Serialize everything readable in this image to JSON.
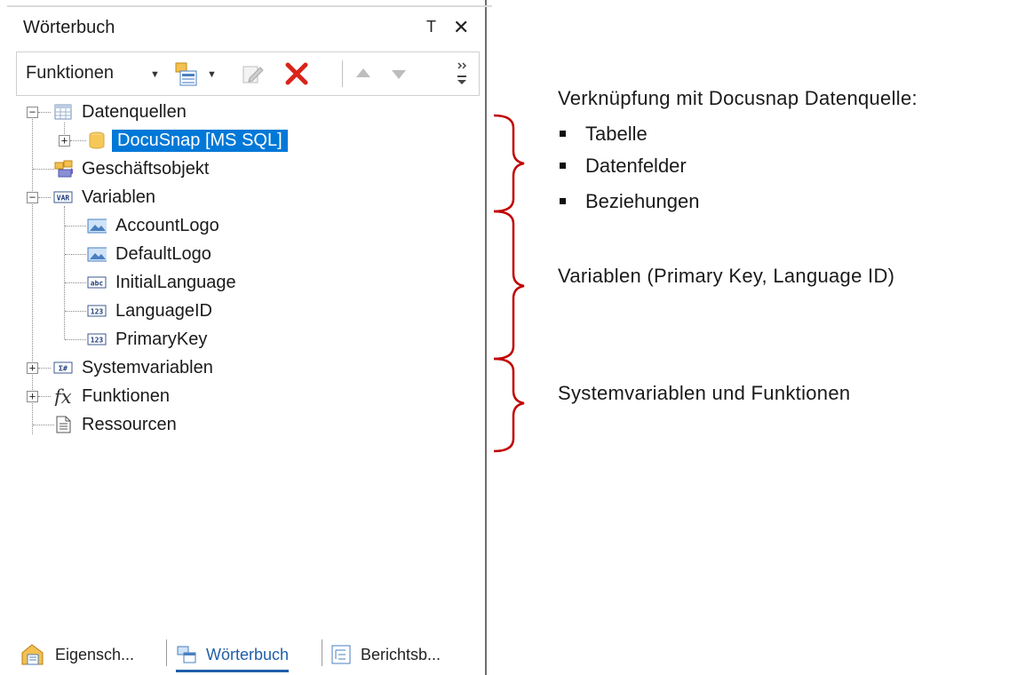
{
  "panel": {
    "title": "Wörterbuch",
    "pin_glyph": "Т",
    "close_glyph": "✕"
  },
  "toolbar": {
    "functions_label": "Funktionen"
  },
  "tree": {
    "datenquellen": "Datenquellen",
    "docusnap": "DocuSnap [MS SQL]",
    "geschaeftsobjekt": "Geschäftsobjekt",
    "variablen": "Variablen",
    "vars": [
      "AccountLogo",
      "DefaultLogo",
      "InitialLanguage",
      "LanguageID",
      "PrimaryKey"
    ],
    "systemvariablen": "Systemvariablen",
    "funktionen": "Funktionen",
    "ressourcen": "Ressourcen"
  },
  "tabs": [
    "Eigensch...",
    "Wörterbuch",
    "Berichtsb..."
  ],
  "annotations": {
    "heading": "Verknüpfung mit Docusnap Datenquelle:",
    "bullets": [
      "Tabelle",
      "Datenfelder",
      "Beziehungen"
    ],
    "variablen_note": "Variablen (Primary Key, Language ID)",
    "system_note": "Systemvariablen und Funktionen"
  },
  "colors": {
    "selection": "#0078d7",
    "bracket": "#c00000",
    "active_tab": "#1f5fa8"
  },
  "icons": {
    "table": "table-icon",
    "database": "database-icon",
    "business_object": "business-object-icon",
    "var": "variable-icon",
    "image": "image-icon",
    "abc": "string-icon",
    "num": "number-icon",
    "sys": "system-variable-icon",
    "fx": "function-icon",
    "res": "resource-icon"
  }
}
